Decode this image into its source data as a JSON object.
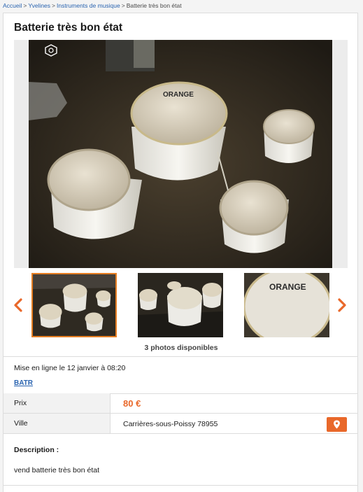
{
  "breadcrumb": {
    "home": "Accueil",
    "region": "Yvelines",
    "category": "Instruments de musique",
    "current": "Batterie très bon état",
    "separator": ">"
  },
  "ad": {
    "title": "Batterie très bon état",
    "photo_count_text": "3 photos disponibles",
    "posted_text": "Mise en ligne le 12 janvier à 08:20",
    "seller": "BATR",
    "price_label": "Prix",
    "price": "80 €",
    "city_label": "Ville",
    "city": "Carrières-sous-Poissy 78955",
    "description_title": "Description :",
    "description": "vend batterie très bon état"
  },
  "gallery": {
    "drum_brand_text": "ORANGE",
    "thumbnails": [
      {
        "name": "thumb-1",
        "selected": true
      },
      {
        "name": "thumb-2",
        "selected": false
      },
      {
        "name": "thumb-3",
        "selected": false
      }
    ]
  },
  "icons": {
    "prev": "chevron-left-icon",
    "next": "chevron-right-icon",
    "map": "map-pin-icon",
    "camera": "camera-badge-icon"
  },
  "colors": {
    "accent": "#e9682a",
    "link": "#2a64b0",
    "selected_border": "#e67e22"
  }
}
